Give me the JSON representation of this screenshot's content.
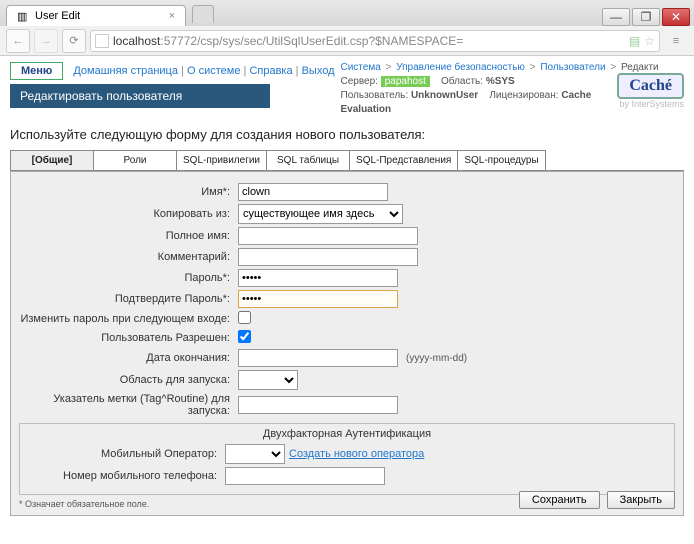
{
  "browser": {
    "tab_title": "User Edit",
    "tab_close": "×",
    "new_tab": "",
    "url_host": "localhost",
    "url_path": ":57772/csp/sys/sec/UtilSqlUserEdit.csp?$NAMESPACE=",
    "nav_back": "←",
    "nav_fwd": "→",
    "nav_reload": "⟳",
    "win_min": "—",
    "win_max": "❐",
    "win_close": "✕",
    "star": "☆",
    "menu": "≡"
  },
  "top": {
    "menu_btn": "Меню",
    "home": "Домашняя страница",
    "about": "О системе",
    "help": "Справка",
    "logout": "Выход",
    "crumb_system": "Система",
    "crumb_sec": "Управление безопасностью",
    "crumb_users": "Пользователи",
    "crumb_edit": "Редакти",
    "sep": " | ",
    "gt": " > ",
    "server_lbl": "Сервер:",
    "server_val": "papahost",
    "region_lbl": "Область:",
    "region_val": "%SYS",
    "user_lbl": "Пользователь:",
    "user_val": "UnknownUser",
    "lic_lbl": "Лицензирован:",
    "lic_val": "Cache Evaluation",
    "cache": "Caché",
    "intersys": "by InterSystems"
  },
  "page": {
    "title_bar": "Редактировать пользователя",
    "intro": "Используйте следующую форму для создания нового пользователя:"
  },
  "tabs": {
    "general": "[Общие]",
    "roles": "Роли",
    "sqlpriv": "SQL-привилегии",
    "sqltables": "SQL таблицы",
    "sqlviews": "SQL-Представления",
    "sqlproc": "SQL-процедуры"
  },
  "form": {
    "name_lbl": "Имя*:",
    "name_val": "clown",
    "copy_lbl": "Копировать из:",
    "copy_sel": "существующее имя здесь",
    "fullname_lbl": "Полное имя:",
    "fullname_val": "",
    "comment_lbl": "Комментарий:",
    "comment_val": "",
    "pwd_lbl": "Пароль*:",
    "pwd_val": "•••••",
    "pwd2_lbl": "Подтвердите Пароль*:",
    "pwd2_val": "•••••",
    "chgpwd_lbl": "Изменить пароль при следующем входе:",
    "enabled_lbl": "Пользователь Разрешен:",
    "expdate_lbl": "Дата окончания:",
    "expdate_val": "",
    "expdate_hint": "(yyyy-mm-dd)",
    "startns_lbl": "Область для запуска:",
    "startrt_lbl": "Указатель метки (Tag^Routine) для запуска:",
    "startrt_val": "",
    "twofa_head": "Двухфакторная Аутентификация",
    "mobop_lbl": "Мобильный Оператор:",
    "mobop_link": "Создать нового оператора",
    "mobnum_lbl": "Номер мобильного телефона:",
    "mobnum_val": "",
    "reqnote": "* Означает обязательное поле.",
    "save_btn": "Сохранить",
    "close_btn": "Закрыть"
  }
}
